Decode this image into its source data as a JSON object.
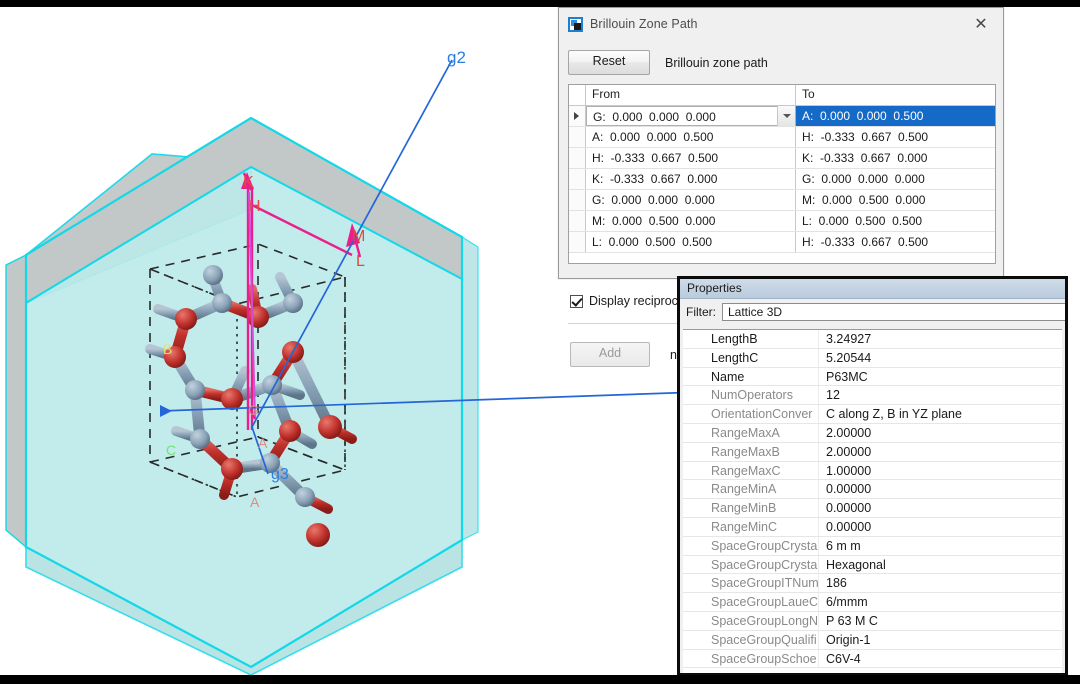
{
  "viewport": {
    "name": "crystal-3d-viewport",
    "labels": {
      "g2": "g2",
      "g3": "g3",
      "K": "K",
      "H": "H",
      "M": "M",
      "L": "L",
      "G": "G",
      "A_upper": "A",
      "A_lower": "A",
      "axis_a": "A",
      "axis_b": "B",
      "axis_c": "C"
    },
    "colors": {
      "zone_face": "#bdeaea",
      "zone_edge": "#13d8e8",
      "zone_top_face": "#c2c8c8",
      "path_line": "#ea1f8d",
      "reciprocal_vector": "#2466d8",
      "atom_red": "#c0302b",
      "atom_blue": "#8ba3b8",
      "label_axis_a": "#d98b8b",
      "label_axis_b": "#e8e86a",
      "label_axis_c": "#6ee86e"
    }
  },
  "brillouin_dialog": {
    "title": "Brillouin Zone Path",
    "icon": "app-icon",
    "close_label": "✕",
    "reset_label": "Reset",
    "toolbar_label": "Brillouin zone path",
    "columns": [
      "From",
      "To"
    ],
    "rows": [
      {
        "from": "G:  0.000  0.000  0.000",
        "to": "A:  0.000  0.000  0.500",
        "current": true,
        "selected": true
      },
      {
        "from": "A:  0.000  0.000  0.500",
        "to": "H:  -0.333  0.667  0.500",
        "current": false,
        "selected": false
      },
      {
        "from": "H:  -0.333  0.667  0.500",
        "to": "K:  -0.333  0.667  0.000",
        "current": false,
        "selected": false
      },
      {
        "from": "K:  -0.333  0.667  0.000",
        "to": "G:  0.000  0.000  0.000",
        "current": false,
        "selected": false
      },
      {
        "from": "G:  0.000  0.000  0.000",
        "to": "M:  0.000  0.500  0.000",
        "current": false,
        "selected": false
      },
      {
        "from": "M:  0.000  0.500  0.000",
        "to": "L:  0.000  0.500  0.500",
        "current": false,
        "selected": false
      },
      {
        "from": "L:  0.000  0.500  0.500",
        "to": "H:  -0.333  0.667  0.500",
        "current": false,
        "selected": false
      }
    ],
    "checkbox_label": "Display reciprocal la",
    "checkbox_checked": true,
    "add_label": "Add",
    "add_enabled": false,
    "new_path_label": "new p"
  },
  "properties_window": {
    "title": "Properties",
    "filter_label": "Filter:",
    "filter_value": "Lattice 3D",
    "rows": [
      {
        "name": "LengthB",
        "value": "3.24927",
        "strong": true
      },
      {
        "name": "LengthC",
        "value": "5.20544",
        "strong": true
      },
      {
        "name": "Name",
        "value": "P63MC",
        "strong": true
      },
      {
        "name": "NumOperators",
        "value": "12",
        "strong": false
      },
      {
        "name": "OrientationConver",
        "value": "C along Z, B in  YZ plane",
        "strong": false
      },
      {
        "name": "RangeMaxA",
        "value": "2.00000",
        "strong": false
      },
      {
        "name": "RangeMaxB",
        "value": "2.00000",
        "strong": false
      },
      {
        "name": "RangeMaxC",
        "value": "1.00000",
        "strong": false
      },
      {
        "name": "RangeMinA",
        "value": "0.00000",
        "strong": false
      },
      {
        "name": "RangeMinB",
        "value": "0.00000",
        "strong": false
      },
      {
        "name": "RangeMinC",
        "value": "0.00000",
        "strong": false
      },
      {
        "name": "SpaceGroupCrysta",
        "value": "6 m m",
        "strong": false
      },
      {
        "name": "SpaceGroupCrysta",
        "value": "Hexagonal",
        "strong": false
      },
      {
        "name": "SpaceGroupITNum",
        "value": "186",
        "strong": false
      },
      {
        "name": "SpaceGroupLaueC",
        "value": "6/mmm",
        "strong": false
      },
      {
        "name": "SpaceGroupLongN",
        "value": "P 63 M C",
        "strong": false
      },
      {
        "name": "SpaceGroupQualifi",
        "value": "Origin-1",
        "strong": false
      },
      {
        "name": "SpaceGroupSchoe",
        "value": "C6V-4",
        "strong": false
      }
    ]
  }
}
